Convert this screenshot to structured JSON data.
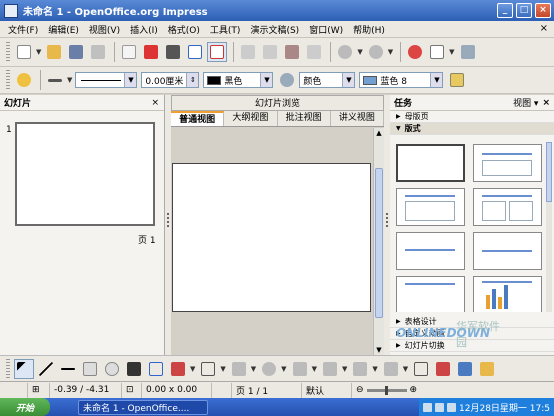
{
  "window": {
    "title": "未命名 1 - OpenOffice.org Impress",
    "controls": [
      "_",
      "□",
      "×"
    ]
  },
  "menubar": {
    "items": [
      "文件(F)",
      "编辑(E)",
      "视图(V)",
      "插入(I)",
      "格式(O)",
      "工具(T)",
      "演示文稿(S)",
      "窗口(W)",
      "帮助(H)"
    ],
    "close": "×"
  },
  "toolbar2": {
    "line_width": "0.00厘米",
    "line_color": "黑色",
    "fill_type": "颜色",
    "fill_color": "蓝色 8"
  },
  "slides_pane": {
    "title": "幻灯片",
    "close": "×",
    "slide_number": "1",
    "page_label": "页 1"
  },
  "center": {
    "title": "幻灯片浏览",
    "tabs": [
      "普通视图",
      "大纲视图",
      "批注视图",
      "讲义视图"
    ],
    "active_tab": 0
  },
  "tasks_pane": {
    "title": "任务",
    "view_label": "视图 ▾",
    "close": "×",
    "sections_top": [
      "母版页",
      "版式"
    ],
    "sections_bottom": [
      "表格设计",
      "自定义动画",
      "幻灯片切换"
    ],
    "watermark_text": "ONLINEDOWN",
    "watermark_cn": "华军软件园"
  },
  "statusbar": {
    "position": "-0.39 / -4.31",
    "size": "0.00 x 0.00",
    "page": "页 1 / 1",
    "layout": "默认"
  },
  "taskbar": {
    "start": "开始",
    "task": "未命名 1 - OpenOffice....",
    "clock": "12月28日星期一 17:5"
  }
}
